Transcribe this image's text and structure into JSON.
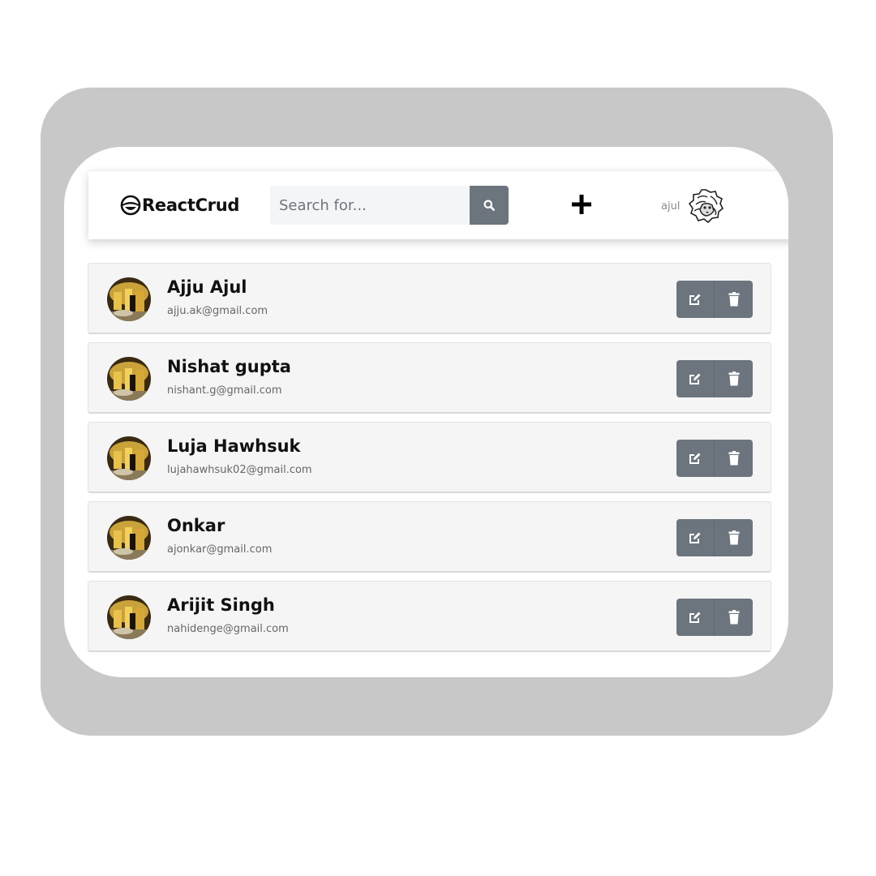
{
  "navbar": {
    "brand": "ReactCrud",
    "search": {
      "placeholder": "Search for...",
      "value": ""
    },
    "user_name": "ajul",
    "icons": {
      "brand": "grinning-face-icon",
      "search": "search-icon",
      "add": "plus-icon",
      "avatar": "lion-avatar-icon"
    }
  },
  "users": [
    {
      "name": "Ajju Ajul",
      "email": "ajju.ak@gmail.com"
    },
    {
      "name": "Nishat gupta",
      "email": "nishant.g@gmail.com"
    },
    {
      "name": "Luja Hawhsuk",
      "email": "lujahawhsuk02@gmail.com"
    },
    {
      "name": "Onkar",
      "email": "ajonkar@gmail.com"
    },
    {
      "name": "Arijit Singh",
      "email": "nahidenge@gmail.com"
    }
  ],
  "row_actions": {
    "edit_icon": "edit-icon",
    "delete_icon": "trash-icon"
  },
  "colors": {
    "frame": "#c8c8c8",
    "button": "#6c757d",
    "row_bg": "#f5f5f5"
  }
}
